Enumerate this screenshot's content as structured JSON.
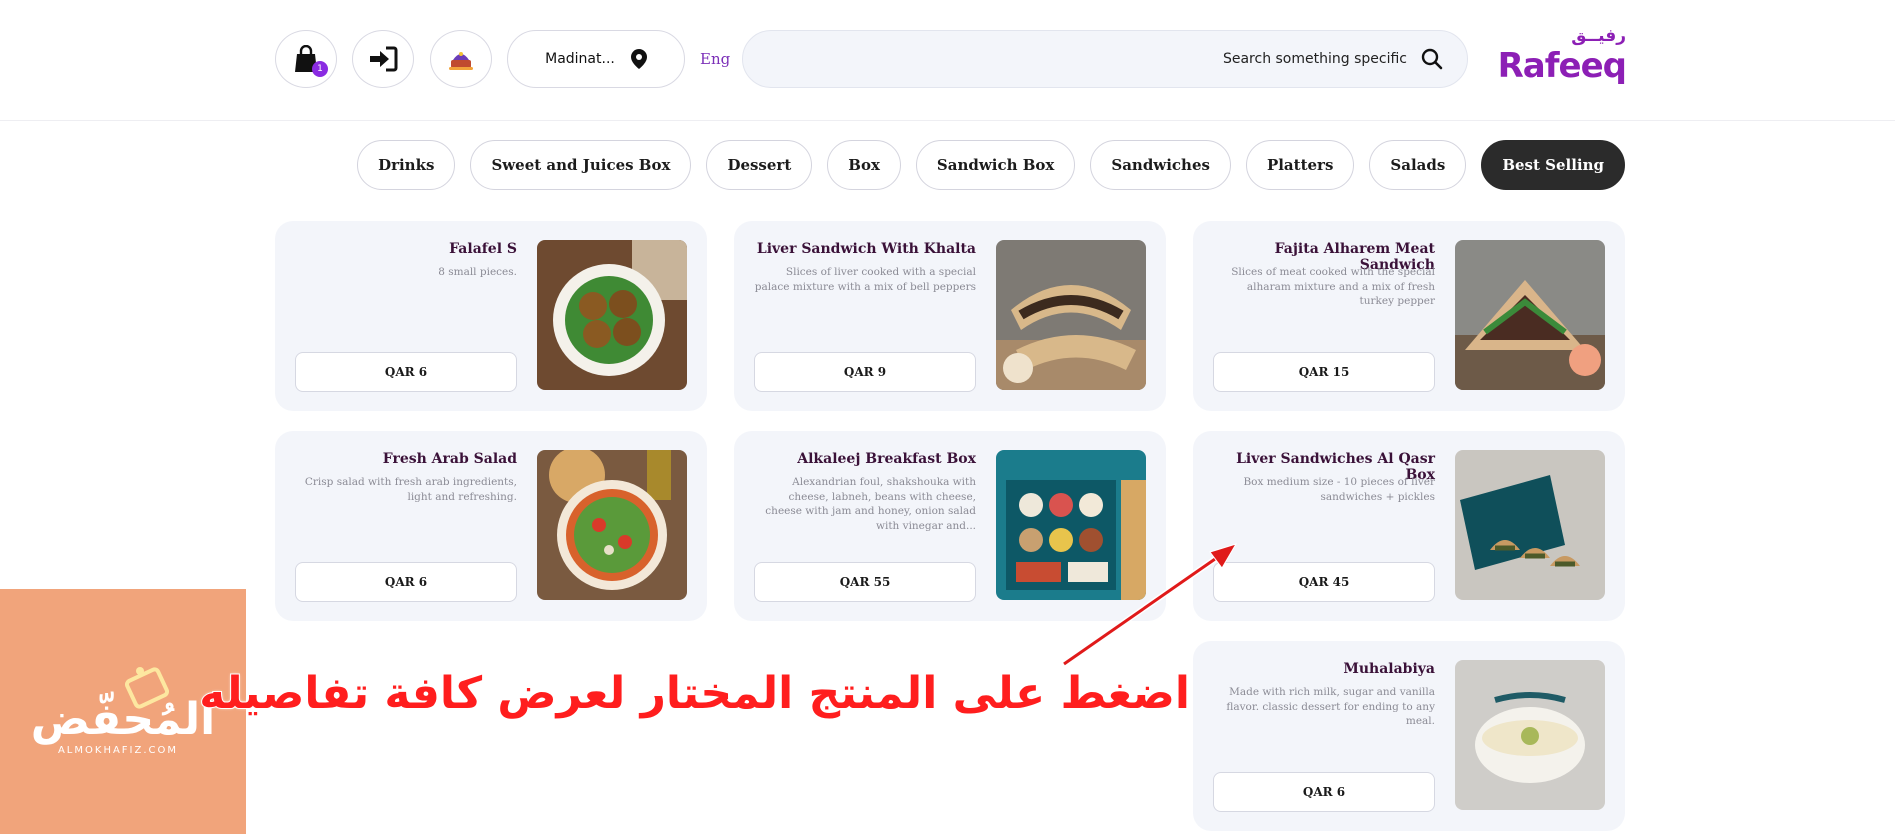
{
  "header": {
    "cart_count": "1",
    "location": "Madinat...",
    "language": "Eng",
    "search_placeholder": "Search something specific",
    "logo_arabic": "رفيــق",
    "logo_english": "Rafeeq"
  },
  "categories": [
    {
      "label": "Best Selling",
      "active": true
    },
    {
      "label": "Salads"
    },
    {
      "label": "Platters"
    },
    {
      "label": "Sandwiches"
    },
    {
      "label": "Sandwich Box"
    },
    {
      "label": "Box"
    },
    {
      "label": "Dessert"
    },
    {
      "label": "Sweet and Juices Box"
    },
    {
      "label": "Drinks"
    }
  ],
  "products": [
    {
      "name": "Fajita Alharem Meat Sandwich",
      "description": "Slices of meat cooked with the special alharam mixture and a mix of fresh turkey pepper",
      "price": "QAR 15"
    },
    {
      "name": "Liver Sandwich With Khalta",
      "description": "Slices of liver cooked with a special palace mixture with a mix of bell peppers",
      "price": "QAR 9"
    },
    {
      "name": "Falafel S",
      "description": "8 small pieces.",
      "price": "QAR 6"
    },
    {
      "name": "Liver Sandwiches Al Qasr Box",
      "description": "Box medium size - 10 pieces of liver sandwiches + pickles",
      "price": "QAR 45"
    },
    {
      "name": "Alkaleej Breakfast Box",
      "description": "Alexandrian foul, shakshouka with cheese, labneh, beans with cheese, cheese with jam and honey, onion salad with vinegar and...",
      "price": "QAR 55"
    },
    {
      "name": "Fresh Arab Salad",
      "description": "Crisp salad with fresh arab ingredients, light and refreshing.",
      "price": "QAR 6"
    },
    {
      "name": "Muhalabiya",
      "description": "Made with rich milk, sugar and vanilla flavor. classic dessert for ending to any meal.",
      "price": "QAR 6"
    }
  ],
  "overlay": {
    "instruction": "اضغط على المنتج المختار لعرض كافة تفاصيله",
    "brand_arabic": "المُحفّض",
    "brand_latin": "ALMOKHAFIZ.COM"
  },
  "colors": {
    "brand": "#8c1fb5",
    "card_bg": "#f3f5fa",
    "active_tab": "#2b2b2b",
    "annotation": "#ff1e1e",
    "overlay_box": "#f1a47b"
  }
}
